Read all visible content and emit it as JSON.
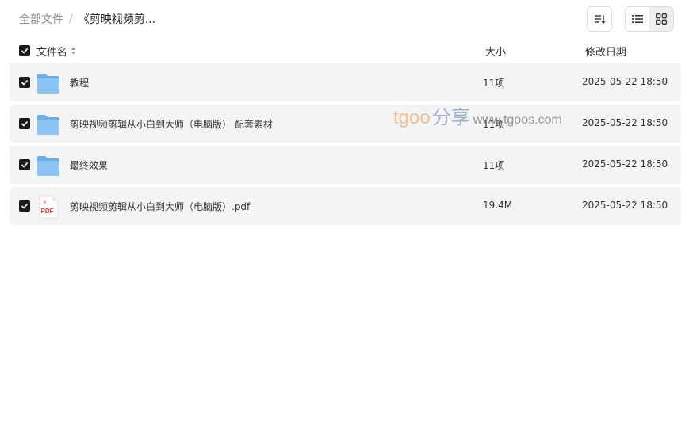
{
  "breadcrumb": {
    "root": "全部文件",
    "separator": "/",
    "current": "《剪映视频剪..."
  },
  "toolbar": {
    "sort_icon": "sort-icon",
    "view_modes": [
      {
        "icon": "list-view-icon",
        "active": false
      },
      {
        "icon": "grid-view-icon",
        "active": true
      }
    ]
  },
  "columns": {
    "name": "文件名",
    "size": "大小",
    "date": "修改日期"
  },
  "files": [
    {
      "type": "folder",
      "name": "教程",
      "size": "11项",
      "date": "2025-05-22 18:50"
    },
    {
      "type": "folder",
      "name": "剪映视频剪辑从小白到大师（电脑版） 配套素材",
      "size": "11项",
      "date": "2025-05-22 18:50"
    },
    {
      "type": "folder",
      "name": "最终效果",
      "size": "11项",
      "date": "2025-05-22 18:50"
    },
    {
      "type": "pdf",
      "name": "剪映视频剪辑从小白到大师（电脑版）.pdf",
      "size": "19.4M",
      "date": "2025-05-22 18:50"
    }
  ],
  "watermark": {
    "brand": "tgoo",
    "cn": "分享",
    "url": "www.tgoos.com"
  },
  "colors": {
    "row_bg": "#f4f4f5",
    "checkbox": "#1a1a1a",
    "folder": "#7fb9f0",
    "pdf_red": "#e03a3a"
  }
}
